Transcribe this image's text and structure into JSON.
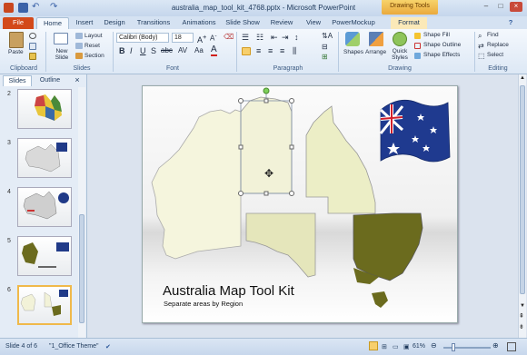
{
  "window": {
    "title": "australia_map_tool_kit_4768.pptx - Microsoft PowerPoint",
    "contextual_tab": "Drawing Tools"
  },
  "tabs": [
    "File",
    "Home",
    "Insert",
    "Design",
    "Transitions",
    "Animations",
    "Slide Show",
    "Review",
    "View",
    "PowerMockup",
    "Format"
  ],
  "ribbon": {
    "clipboard": {
      "paste": "Paste",
      "label": "Clipboard"
    },
    "slides": {
      "new_slide": "New Slide",
      "layout": "Layout",
      "reset": "Reset",
      "section": "Section",
      "label": "Slides"
    },
    "font": {
      "name": "Calibri (Body)",
      "size": "18",
      "label": "Font"
    },
    "paragraph": {
      "label": "Paragraph"
    },
    "drawing": {
      "shapes": "Shapes",
      "arrange": "Arrange",
      "quick_styles": "Quick Styles",
      "shape_fill": "Shape Fill",
      "shape_outline": "Shape Outline",
      "shape_effects": "Shape Effects",
      "label": "Drawing"
    },
    "editing": {
      "find": "Find",
      "replace": "Replace",
      "select": "Select",
      "label": "Editing"
    }
  },
  "pane": {
    "tab_slides": "Slides",
    "tab_outline": "Outline",
    "close": "×",
    "thumbnails": [
      "2",
      "3",
      "4",
      "5",
      "6"
    ],
    "selected": "6"
  },
  "slide": {
    "title": "Australia Map Tool Kit",
    "subtitle": "Separate areas by Region"
  },
  "status": {
    "slide_info": "Slide 4 of 6",
    "theme": "\"1_Office Theme\"",
    "zoom": "61%",
    "zoom_level": 0.61
  },
  "colors": {
    "accent": "#2b579a",
    "file_tab": "#d3491a",
    "drawing_tools": "#f0b94a",
    "nsw": "#6b6b1e",
    "region_light": "#f2f2d8",
    "region_mid": "#e8e9bf"
  }
}
